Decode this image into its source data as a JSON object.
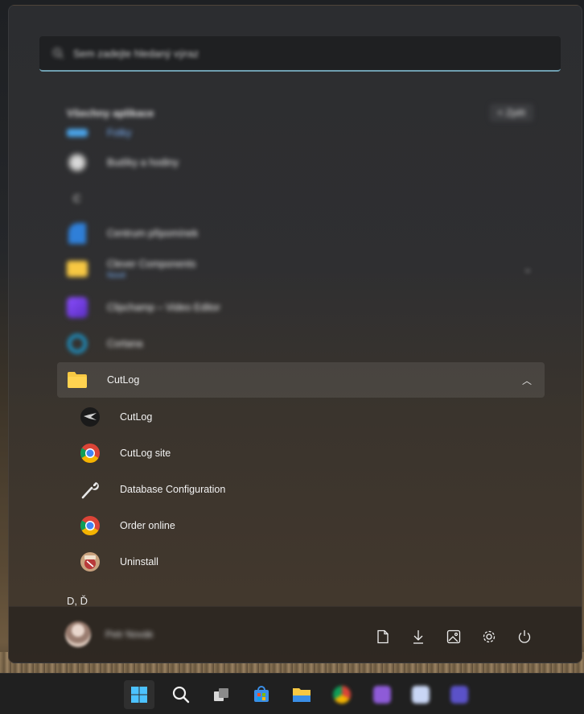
{
  "search": {
    "placeholder": "Sem zadejte hledaný výraz"
  },
  "all_apps": {
    "title": "Všechny aplikace",
    "back_label": "< Zpět"
  },
  "apps": [
    {
      "label": "Fotky"
    },
    {
      "label": "Budíky a hodiny"
    },
    {
      "letter": "C"
    },
    {
      "label": "Centrum připomínek"
    },
    {
      "label": "Clever Components",
      "sub": "Nové"
    },
    {
      "label": "Clipchamp – Video Editor"
    },
    {
      "label": "Cortana"
    }
  ],
  "folder": {
    "label": "CutLog",
    "items": [
      {
        "label": "CutLog",
        "icon": "cutlog-icon"
      },
      {
        "label": "CutLog site",
        "icon": "chrome-icon"
      },
      {
        "label": "Database Configuration",
        "icon": "wrench-icon"
      },
      {
        "label": "Order online",
        "icon": "chrome-icon"
      },
      {
        "label": "Uninstall",
        "icon": "uninstall-icon"
      }
    ]
  },
  "next_letter": "D, Ď",
  "footer": {
    "user_name": "Petr Novák",
    "buttons": [
      "documents-icon",
      "downloads-icon",
      "pictures-icon",
      "settings-icon",
      "power-icon"
    ]
  },
  "taskbar": {
    "items": [
      "start-icon",
      "search-icon",
      "task-view-icon",
      "store-icon",
      "file-explorer-icon",
      "chrome-icon",
      "visual-studio-icon",
      "app-icon",
      "app-icon"
    ]
  },
  "colors": {
    "accent": "#6f9fb0",
    "folder": "#f7c843",
    "link_blue": "#7fb7ff"
  }
}
